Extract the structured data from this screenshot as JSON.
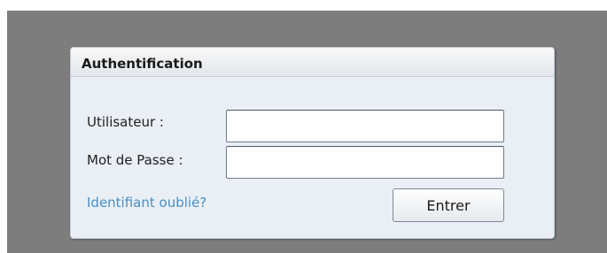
{
  "dialog": {
    "title": "Authentification"
  },
  "form": {
    "username_label": "Utilisateur :",
    "username_value": "",
    "password_label": "Mot de Passe :",
    "password_value": "",
    "forgot_link": "Identifiant oublié?",
    "submit_label": "Entrer"
  },
  "colors": {
    "backdrop": "#7d7d7d",
    "dialog_bg": "#e9eff5",
    "link": "#4a8fc4"
  }
}
